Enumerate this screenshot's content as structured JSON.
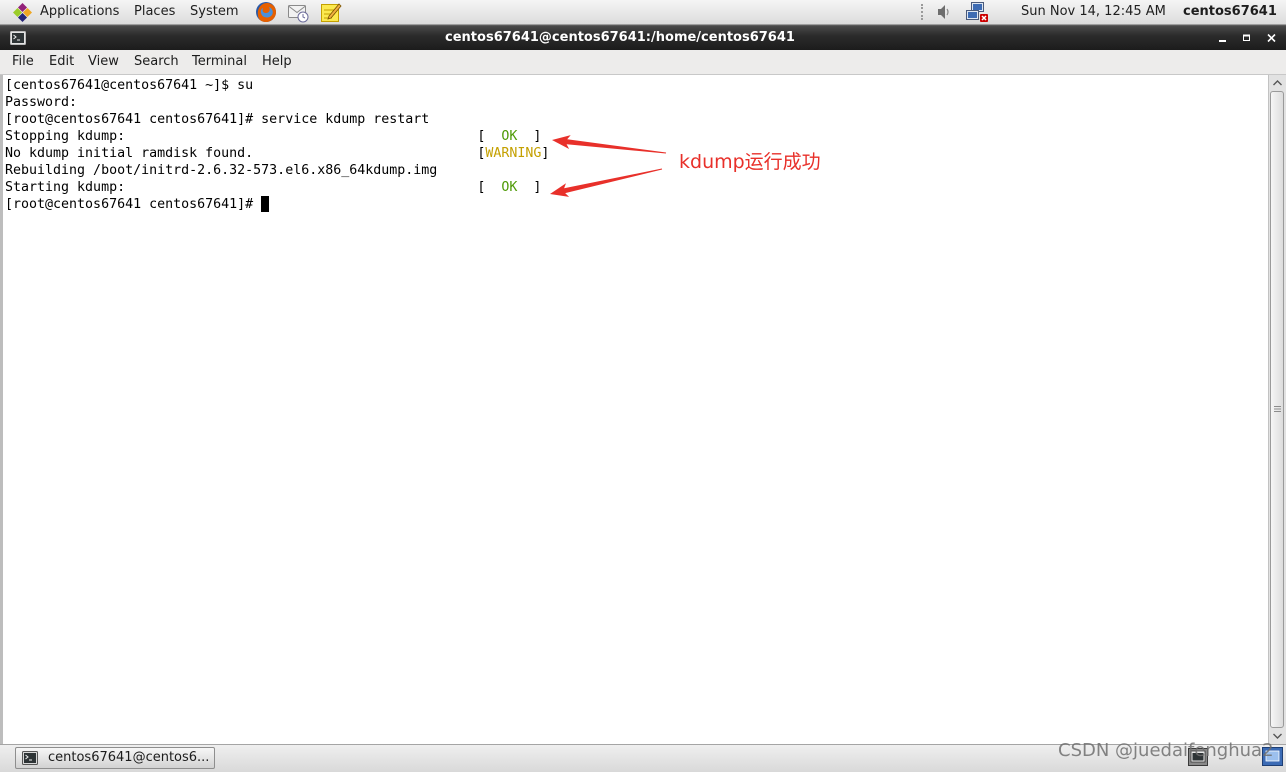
{
  "top_panel": {
    "menus": [
      {
        "label": "Applications",
        "icon": "centos-logo-icon"
      },
      {
        "label": "Places"
      },
      {
        "label": "System"
      }
    ],
    "launchers": [
      {
        "icon": "firefox-icon"
      },
      {
        "icon": "evolution-mail-icon"
      },
      {
        "icon": "notes-icon"
      }
    ],
    "tray": [
      {
        "icon": "volume-icon"
      },
      {
        "icon": "network-disconnected-icon"
      }
    ],
    "clock": "Sun Nov 14, 12:45 AM",
    "user": "centos67641"
  },
  "window": {
    "icon": "terminal-icon",
    "title": "centos67641@centos67641:/home/centos67641",
    "controls": [
      "minimize-icon",
      "maximize-icon",
      "close-icon"
    ],
    "menu": [
      {
        "label": "File"
      },
      {
        "label": "Edit"
      },
      {
        "label": "View"
      },
      {
        "label": "Search"
      },
      {
        "label": "Terminal"
      },
      {
        "label": "Help"
      }
    ]
  },
  "terminal": {
    "lines": [
      {
        "text": "[centos67641@centos67641 ~]$ su"
      },
      {
        "text": "Password:"
      },
      {
        "text": "[root@centos67641 centos67641]# service kdump restart"
      },
      {
        "text": "Stopping kdump:",
        "status": {
          "open": "[  ",
          "word": "OK",
          "close": "  ]",
          "color": "#4e9a06"
        }
      },
      {
        "text": "No kdump initial ramdisk found.",
        "status": {
          "open": "[",
          "word": "WARNING",
          "close": "]",
          "color": "#c4a000"
        }
      },
      {
        "text": "Rebuilding /boot/initrd-2.6.32-573.el6.x86_64kdump.img"
      },
      {
        "text": "Starting kdump:",
        "status": {
          "open": "[  ",
          "word": "OK",
          "close": "  ]",
          "color": "#4e9a06"
        }
      },
      {
        "text": "[root@centos67641 centos67641]# "
      }
    ]
  },
  "annotation": {
    "text": "kdump运行成功",
    "color": "#e8302a"
  },
  "bottom_panel": {
    "tasks": [
      {
        "icon": "terminal-icon",
        "label": "centos67641@centos6..."
      }
    ],
    "workspaces": [
      {
        "icon": "workspace-icon"
      },
      {
        "icon": "workspace-icon"
      }
    ]
  },
  "watermark": "CSDN @juedaifenghua2",
  "colors": {
    "title_bar": "#2b2b2b",
    "terminal_background": "#ffffff",
    "status_ok": "#4e9a06",
    "status_warning": "#c4a000",
    "annotation": "#e8302a"
  }
}
